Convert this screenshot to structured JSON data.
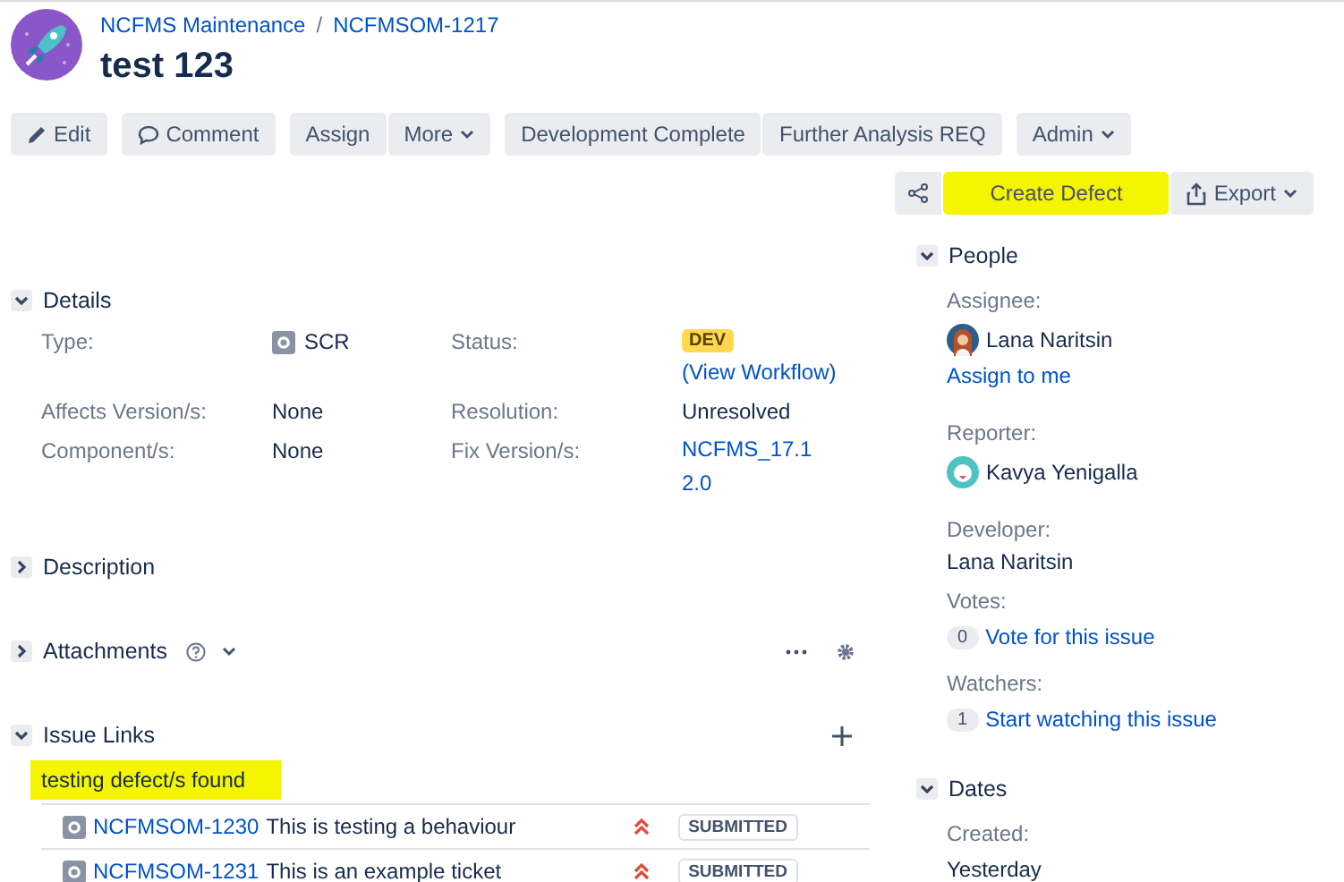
{
  "header": {
    "breadcrumbs": [
      "NCFMS Maintenance",
      "NCFMSOM-1217"
    ],
    "separator": "/",
    "title": "test 123"
  },
  "toolbar": [
    {
      "label": "Edit",
      "dropdown": false
    },
    {
      "label": "Comment",
      "dropdown": false
    },
    {
      "label": "Assign",
      "dropdown": false
    },
    {
      "label": "More",
      "dropdown": true
    },
    {
      "label": "Development Complete",
      "dropdown": false
    },
    {
      "label": "Further Analysis REQ",
      "dropdown": false
    },
    {
      "label": "Admin",
      "dropdown": true
    }
  ],
  "actions": [
    {
      "label": "Create Defect",
      "highlighted": true,
      "dropdown": false
    },
    {
      "label": "Export",
      "highlighted": false,
      "dropdown": true
    }
  ],
  "details": {
    "title": "Details",
    "expanded": true,
    "fields": [
      {
        "label": "Type:",
        "value": "SCR",
        "kind": "type"
      },
      {
        "label": "Status:",
        "value": "DEV",
        "link": "(View Workflow)",
        "kind": "status"
      },
      {
        "label": "Affects Version/s:",
        "value": "None",
        "kind": "text"
      },
      {
        "label": "Resolution:",
        "value": "Unresolved",
        "kind": "text"
      },
      {
        "label": "Component/s:",
        "value": "None",
        "kind": "text"
      },
      {
        "label": "Fix Version/s:",
        "value": "NCFMS_17.12.0",
        "kind": "link"
      }
    ]
  },
  "description": {
    "title": "Description",
    "expanded": false
  },
  "attachments": {
    "title": "Attachments",
    "expanded": false
  },
  "issue_links": {
    "title": "Issue Links",
    "expanded": true,
    "group": {
      "label": "testing defect/s found",
      "highlighted": true
    },
    "links": [
      {
        "key": "NCFMSOM-1230",
        "summary": "This is testing a behaviour",
        "status": "SUBMITTED"
      },
      {
        "key": "NCFMSOM-1231",
        "summary": "This is an example ticket",
        "status": "SUBMITTED"
      }
    ]
  },
  "people": {
    "title": "People",
    "expanded": true,
    "assignee": {
      "label": "Assignee:",
      "name": "Lana Naritsin",
      "action": "Assign to me"
    },
    "reporter": {
      "label": "Reporter:",
      "name": "Kavya Yenigalla"
    },
    "developer": {
      "label": "Developer:",
      "name": "Lana Naritsin"
    },
    "votes": {
      "label": "Votes:",
      "count": "0",
      "action": "Vote for this issue"
    },
    "watchers": {
      "label": "Watchers:",
      "count": "1",
      "action": "Start watching this issue"
    }
  },
  "dates": {
    "title": "Dates",
    "expanded": true,
    "created": {
      "label": "Created:",
      "value": "Yesterday"
    }
  }
}
